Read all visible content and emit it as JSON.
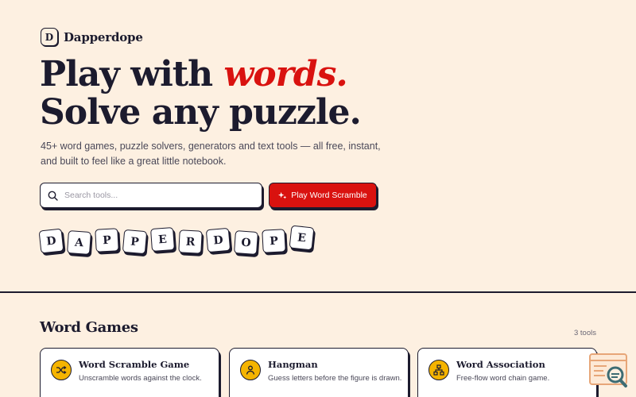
{
  "brand": {
    "logo_letter": "D",
    "name": "Dapperdope"
  },
  "hero": {
    "line1_prefix": "Play with ",
    "line1_accent": "words.",
    "line2": "Solve any puzzle."
  },
  "subtitle": "45+ word games, puzzle solvers, generators and text tools — all free, instant, and built to feel like a great little notebook.",
  "search": {
    "placeholder": "Search tools..."
  },
  "cta": {
    "label": "Play Word Scramble"
  },
  "tiles": [
    "D",
    "A",
    "P",
    "P",
    "E",
    "R",
    "D",
    "O",
    "P",
    "E"
  ],
  "section": {
    "title": "Word Games",
    "count": "3 tools"
  },
  "cards": [
    {
      "title": "Word Scramble Game",
      "desc": "Unscramble words against the clock.",
      "icon": "shuffle-icon"
    },
    {
      "title": "Hangman",
      "desc": "Guess letters before the figure is drawn.",
      "icon": "person-icon"
    },
    {
      "title": "Word Association",
      "desc": "Free-flow word chain game.",
      "icon": "network-icon"
    }
  ],
  "colors": {
    "background": "#fdf0e1",
    "accent": "#d9120f",
    "ink": "#1c1b2e",
    "icon_badge": "#f5b400"
  }
}
